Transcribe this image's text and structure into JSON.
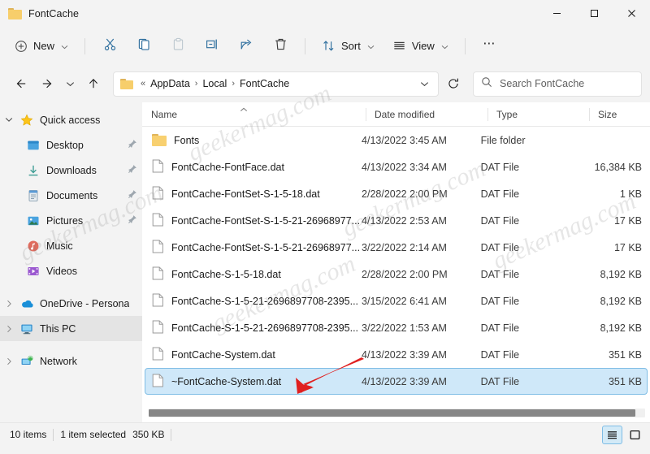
{
  "window": {
    "title": "FontCache",
    "folder_icon": "folder-icon",
    "minimize_label": "Minimize",
    "maximize_label": "Maximize",
    "close_label": "Close"
  },
  "toolbar": {
    "new_label": "New",
    "new_icon": "plus-circle-icon",
    "cut_label": "Cut",
    "cut_icon": "scissors-icon",
    "copy_label": "Copy",
    "copy_icon": "copy-icon",
    "paste_label": "Paste",
    "paste_icon": "clipboard-icon",
    "rename_label": "Rename",
    "rename_icon": "rename-icon",
    "share_label": "Share",
    "share_icon": "share-icon",
    "delete_label": "Delete",
    "delete_icon": "trash-icon",
    "sort_label": "Sort",
    "sort_icon": "sort-arrows-icon",
    "view_label": "View",
    "view_icon": "list-lines-icon",
    "more_label": "See more",
    "more_icon": "ellipsis-icon"
  },
  "addressbar": {
    "back_icon": "arrow-left-icon",
    "forward_icon": "arrow-right-icon",
    "recent_icon": "chevron-down-icon",
    "up_icon": "arrow-up-icon",
    "refresh_icon": "refresh-icon",
    "folder_icon": "folder-icon",
    "overflow": "«",
    "crumbs": [
      "AppData",
      "Local",
      "FontCache"
    ],
    "separator": "›",
    "dropdown_icon": "chevron-down-icon"
  },
  "search": {
    "icon": "search-icon",
    "placeholder": "Search FontCache",
    "value": ""
  },
  "sidebar": {
    "groups": [
      {
        "label": "Quick access",
        "icon": "star-icon",
        "expander": "chevron-down-icon",
        "expanded": true,
        "items": [
          {
            "label": "Desktop",
            "icon": "desktop-icon",
            "pinned": true
          },
          {
            "label": "Downloads",
            "icon": "download-icon",
            "pinned": true
          },
          {
            "label": "Documents",
            "icon": "documents-icon",
            "pinned": true
          },
          {
            "label": "Pictures",
            "icon": "pictures-icon",
            "pinned": true
          },
          {
            "label": "Music",
            "icon": "music-icon",
            "pinned": false
          },
          {
            "label": "Videos",
            "icon": "videos-icon",
            "pinned": false
          }
        ]
      }
    ],
    "roots": [
      {
        "label": "OneDrive - Persona",
        "icon": "onedrive-icon",
        "expander": "chevron-right-icon",
        "hovered": false
      },
      {
        "label": "This PC",
        "icon": "thispc-icon",
        "expander": "chevron-right-icon",
        "hovered": true
      },
      {
        "label": "Network",
        "icon": "network-icon",
        "expander": "chevron-right-icon",
        "hovered": false
      }
    ]
  },
  "filelist": {
    "columns": [
      {
        "key": "name",
        "label": "Name",
        "sorted": true,
        "sort_icon": "chevron-up-icon"
      },
      {
        "key": "date",
        "label": "Date modified",
        "sorted": false
      },
      {
        "key": "type",
        "label": "Type",
        "sorted": false
      },
      {
        "key": "size",
        "label": "Size",
        "sorted": false
      }
    ],
    "rows": [
      {
        "name": "Fonts",
        "date": "4/13/2022 3:45 AM",
        "type": "File folder",
        "size": "",
        "icon": "folder-icon",
        "selected": false
      },
      {
        "name": "FontCache-FontFace.dat",
        "date": "4/13/2022 3:34 AM",
        "type": "DAT File",
        "size": "16,384 KB",
        "icon": "dat-file-icon",
        "selected": false
      },
      {
        "name": "FontCache-FontSet-S-1-5-18.dat",
        "date": "2/28/2022 2:00 PM",
        "type": "DAT File",
        "size": "1 KB",
        "icon": "dat-file-icon",
        "selected": false
      },
      {
        "name": "FontCache-FontSet-S-1-5-21-26968977...",
        "date": "4/13/2022 2:53 AM",
        "type": "DAT File",
        "size": "17 KB",
        "icon": "dat-file-icon",
        "selected": false
      },
      {
        "name": "FontCache-FontSet-S-1-5-21-26968977...",
        "date": "3/22/2022 2:14 AM",
        "type": "DAT File",
        "size": "17 KB",
        "icon": "dat-file-icon",
        "selected": false
      },
      {
        "name": "FontCache-S-1-5-18.dat",
        "date": "2/28/2022 2:00 PM",
        "type": "DAT File",
        "size": "8,192 KB",
        "icon": "dat-file-icon",
        "selected": false
      },
      {
        "name": "FontCache-S-1-5-21-2696897708-2395...",
        "date": "3/15/2022 6:41 AM",
        "type": "DAT File",
        "size": "8,192 KB",
        "icon": "dat-file-icon",
        "selected": false
      },
      {
        "name": "FontCache-S-1-5-21-2696897708-2395...",
        "date": "3/22/2022 1:53 AM",
        "type": "DAT File",
        "size": "8,192 KB",
        "icon": "dat-file-icon",
        "selected": false
      },
      {
        "name": "FontCache-System.dat",
        "date": "4/13/2022 3:39 AM",
        "type": "DAT File",
        "size": "351 KB",
        "icon": "dat-file-icon",
        "selected": false
      },
      {
        "name": "~FontCache-System.dat",
        "date": "4/13/2022 3:39 AM",
        "type": "DAT File",
        "size": "351 KB",
        "icon": "dat-file-icon",
        "selected": true
      }
    ]
  },
  "statusbar": {
    "item_count": "10 items",
    "selection": "1 item selected",
    "selection_size": "350 KB",
    "details_view_icon": "details-view-icon",
    "details_view_active": true,
    "large_icons_view_icon": "large-icons-view-icon"
  },
  "annotation": {
    "arrow_color": "#e02020",
    "points_to": "~FontCache-System.dat"
  },
  "watermarks": [
    "geekermag.com",
    "geekermag.com",
    "geekermag.com",
    "geekermag.com",
    "geekermag.com"
  ],
  "colors": {
    "selection_fill": "#cfe8f9",
    "selection_border": "#7fbde5",
    "chrome": "#f3f3f3",
    "accent_icon": "#2b6ca3"
  }
}
